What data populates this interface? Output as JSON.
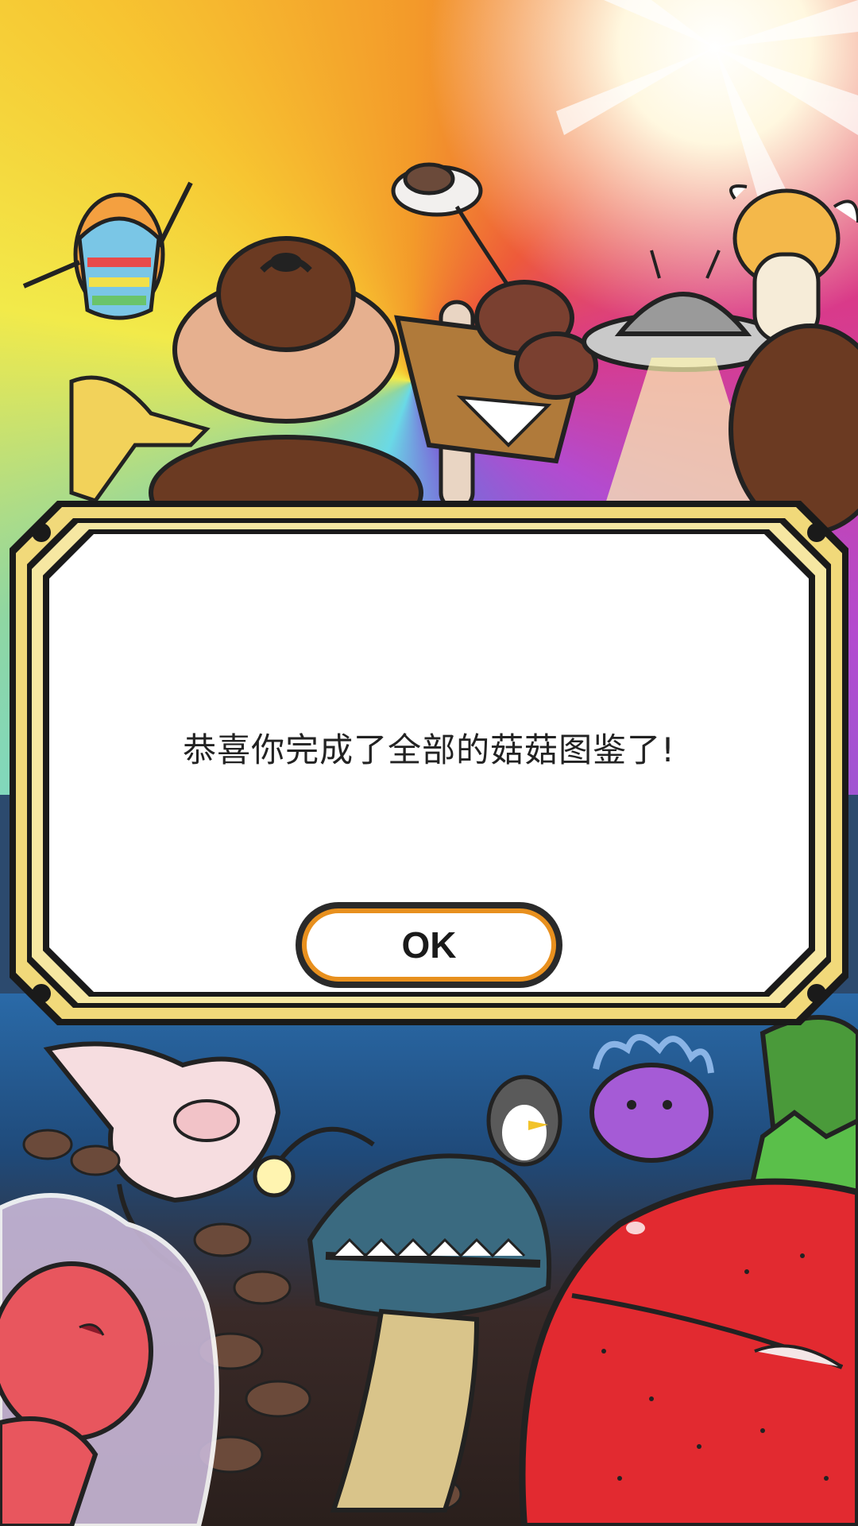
{
  "dialog": {
    "message": "恭喜你完成了全部的菇菇图鉴了!",
    "ok_label": "OK"
  },
  "colors": {
    "frame_gold": "#f1d97a",
    "frame_dark": "#1a1a1a",
    "button_orange": "#e8901e"
  },
  "background": {
    "characters": [
      "rainbow-mushroom-icon",
      "sumo-mushroom-icon",
      "enoki-mushroom-icon",
      "mushroom-basket-icon",
      "ufo-icon",
      "angel-mushroom-icon",
      "banana-mushroom-icon",
      "pink-mushroom-icon",
      "anglerfish-mushroom-icon",
      "penguin-icon",
      "anemone-icon",
      "strawberry-mushroom-icon",
      "shell-mushroom-icon"
    ]
  }
}
